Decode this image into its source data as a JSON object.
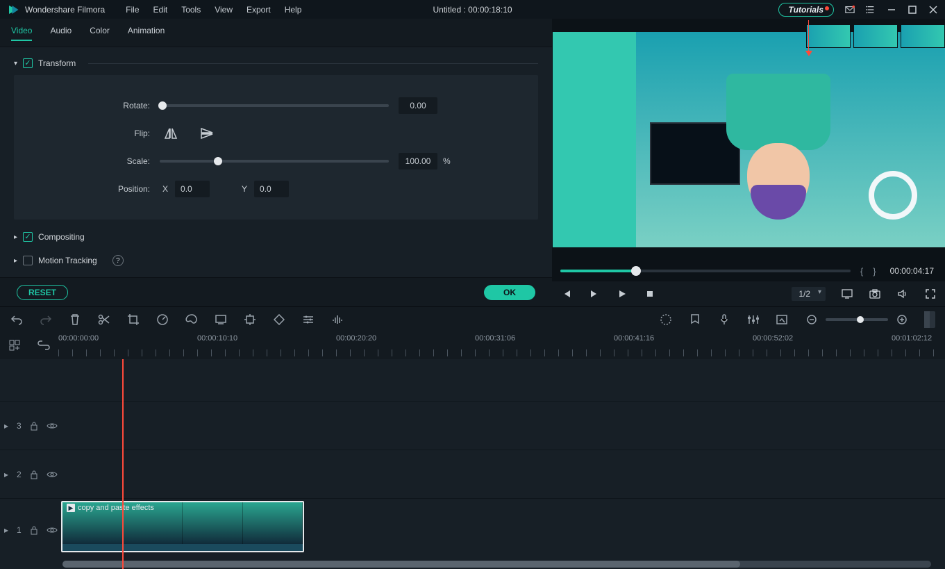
{
  "app": {
    "title": "Wondershare Filmora"
  },
  "menu": {
    "file": "File",
    "edit": "Edit",
    "tools": "Tools",
    "view": "View",
    "export": "Export",
    "help": "Help"
  },
  "title_center": "Untitled : 00:00:18:10",
  "tutorials": {
    "label": "Tutorials"
  },
  "inspector": {
    "tabs": {
      "video": "Video",
      "audio": "Audio",
      "color": "Color",
      "animation": "Animation"
    },
    "transform": {
      "title": "Transform",
      "rotate_label": "Rotate:",
      "rotate_value": "0.00",
      "flip_label": "Flip:",
      "scale_label": "Scale:",
      "scale_value": "100.00",
      "scale_unit": "%",
      "position_label": "Position:",
      "pos_x_label": "X",
      "pos_x_value": "0.0",
      "pos_y_label": "Y",
      "pos_y_value": "0.0"
    },
    "compositing": {
      "title": "Compositing"
    },
    "motion_tracking": {
      "title": "Motion Tracking"
    },
    "reset": "RESET",
    "ok": "OK"
  },
  "preview": {
    "timecode": "00:00:04:17",
    "zoom": "1/2"
  },
  "ruler": {
    "tc0": "00:00:00:00",
    "tc1": "00:00:10:10",
    "tc2": "00:00:20:20",
    "tc3": "00:00:31:06",
    "tc4": "00:00:41:16",
    "tc5": "00:00:52:02",
    "tc6": "00:01:02:12"
  },
  "tracks": {
    "t3": "3",
    "t2": "2",
    "t1": "1"
  },
  "clip": {
    "label": "copy and paste effects"
  }
}
